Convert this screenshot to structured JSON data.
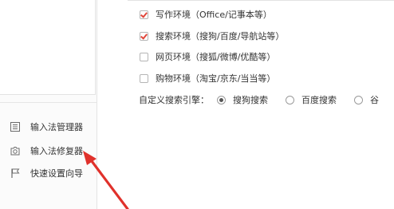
{
  "environments": [
    {
      "label": "写作环境（Office/记事本等）",
      "checked": true
    },
    {
      "label": "搜索环境（搜狗/百度/导航站等）",
      "checked": true
    },
    {
      "label": "网页环境（搜狐/微博/优酷等）",
      "checked": false
    },
    {
      "label": "购物环境（淘宝/京东/当当等）",
      "checked": false
    }
  ],
  "search_engine": {
    "label": "自定义搜索引擎：",
    "options": [
      {
        "label": "搜狗搜索",
        "selected": true
      },
      {
        "label": "百度搜索",
        "selected": false
      },
      {
        "label": "谷",
        "selected": false
      }
    ]
  },
  "sidebar": {
    "items": [
      {
        "label": "输入法管理器",
        "icon": "list-icon"
      },
      {
        "label": "输入法修复器",
        "icon": "repair-icon"
      },
      {
        "label": "快速设置向导",
        "icon": "flag-icon"
      }
    ]
  },
  "colors": {
    "check_accent": "#e0463a",
    "arrow": "#e0312b"
  }
}
